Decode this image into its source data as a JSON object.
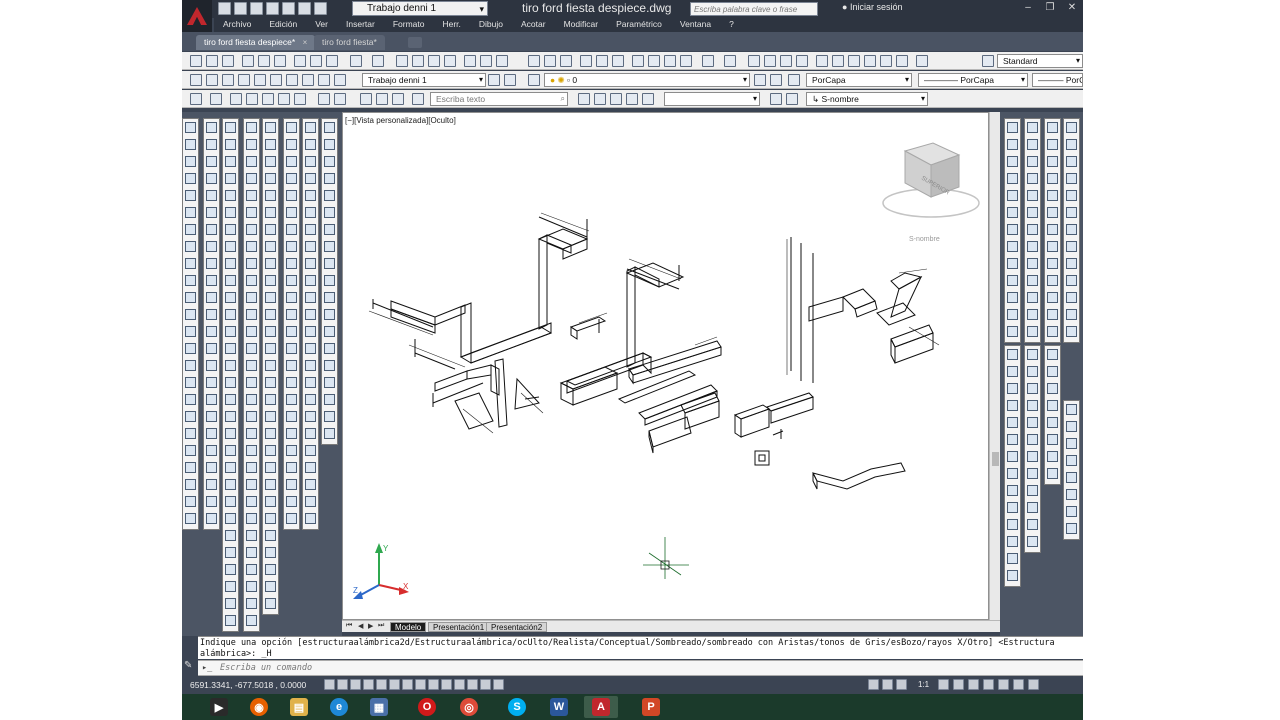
{
  "window": {
    "document_title": "tiro ford fiesta despiece.dwg",
    "workspace": "Trabajo denni 1",
    "search_placeholder": "Escriba palabra clave o frase",
    "sign_in": "Iniciar sesión"
  },
  "menu": [
    "Archivo",
    "Edición",
    "Ver",
    "Insertar",
    "Formato",
    "Herr.",
    "Dibujo",
    "Acotar",
    "Modificar",
    "Paramétrico",
    "Ventana",
    "?"
  ],
  "tabs": [
    {
      "label": "tiro ford fiesta despiece*",
      "close": "×"
    },
    {
      "label": "tiro ford fiesta*"
    }
  ],
  "toolbars": {
    "workspace_combo": "Trabajo denni 1",
    "layer_combo": "0",
    "color_combo": "PorCapa",
    "linetype_combo": "PorCapa",
    "lineweight_combo": "PorC",
    "text_style_combo": "Standard",
    "text_input_placeholder": "Escriba texto",
    "named_view_combo": "S-nombre"
  },
  "viewport": {
    "view_label": "[−][Vista personalizada][Oculto]",
    "viewcube_face": "SUPERIOR",
    "ucs_combo": "S-nombre",
    "axis_x": "X",
    "axis_y": "Y",
    "axis_z": "Z"
  },
  "layout_tabs": [
    "Modelo",
    "Presentación1",
    "Presentación2"
  ],
  "command": {
    "history_line1": "Indique una opción [estructuraalámbrica2d/Estructuraalámbrica/ocUlto/Realista/Conceptual/Sombreado/sombreado con Aristas/tonos de Gris/esBozo/rayos X/Otro] <Estructura",
    "history_line2": "alámbrica>: _H",
    "prompt_placeholder": "Escriba un comando"
  },
  "status": {
    "coordinates": "6591.3341, -677.5018 , 0.0000",
    "scale": "1:1"
  },
  "colors": {
    "app_background": "#3b4453",
    "viewport_background": "#ffffff",
    "autocad_red": "#c1272d",
    "taskbar": "#1b3a2b"
  },
  "taskbar_icons": [
    "media-player-icon",
    "firefox-icon",
    "file-explorer-icon",
    "internet-explorer-icon",
    "calculator-icon",
    "opera-icon",
    "chrome-icon",
    "skype-icon",
    "word-icon",
    "autocad-icon",
    "powerpoint-icon"
  ]
}
